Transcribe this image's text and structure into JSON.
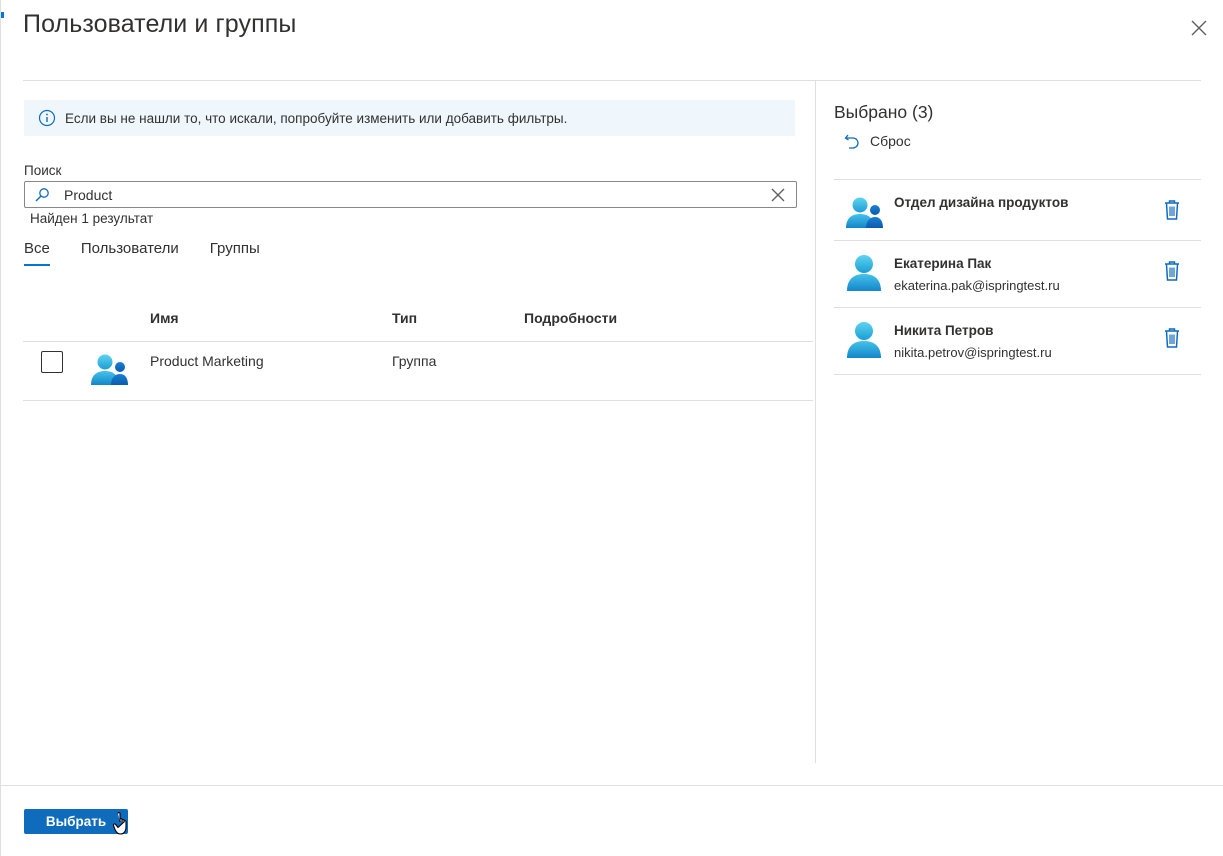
{
  "header": {
    "title": "Пользователи и группы"
  },
  "info_bar": {
    "text": "Если вы не нашли то, что искали, попробуйте изменить или добавить фильтры."
  },
  "search": {
    "label": "Поиск",
    "value": "Product",
    "result_count": "Найден 1 результат"
  },
  "tabs": [
    {
      "label": "Все",
      "active": true
    },
    {
      "label": "Пользователи",
      "active": false
    },
    {
      "label": "Группы",
      "active": false
    }
  ],
  "table": {
    "columns": [
      "Имя",
      "Тип",
      "Подробности"
    ],
    "rows": [
      {
        "name": "Product Marketing",
        "type": "Группа",
        "details": "",
        "checked": false,
        "icon": "group-icon"
      }
    ]
  },
  "selected": {
    "title": "Выбрано (3)",
    "reset_label": "Сброс",
    "items": [
      {
        "name": "Отдел дизайна продуктов",
        "email": "",
        "icon": "group-icon"
      },
      {
        "name": "Екатерина Пак",
        "email": "ekaterina.pak@ispringtest.ru",
        "icon": "user-icon"
      },
      {
        "name": "Никита Петров",
        "email": "nikita.petrov@ispringtest.ru",
        "icon": "user-icon"
      }
    ]
  },
  "footer": {
    "primary_label": "Выбрать"
  },
  "colors": {
    "accent": "#0078d4",
    "button": "#0f6cbd",
    "info_bg": "#eff6fc",
    "divider": "#e1dfdd"
  }
}
